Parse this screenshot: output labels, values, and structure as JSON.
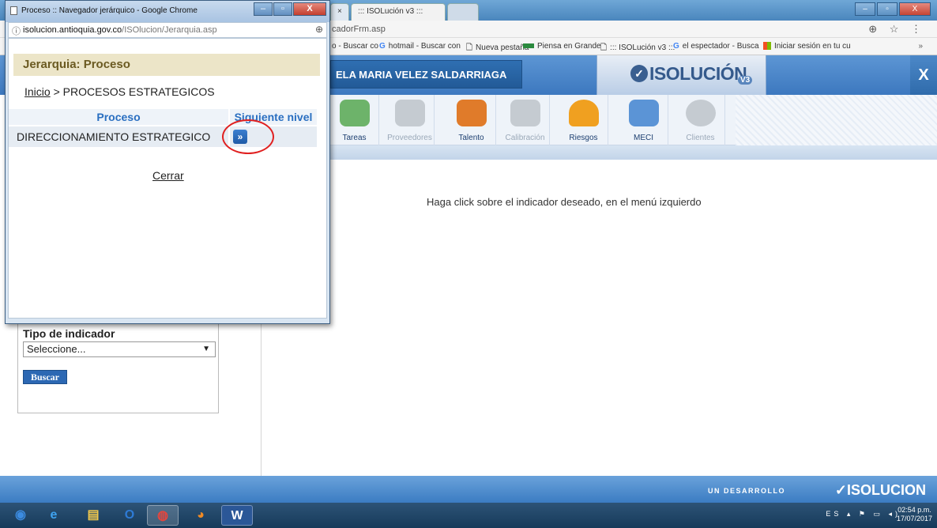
{
  "browser": {
    "tab_title": "::: ISOLución v3 :::",
    "tab_close": "×",
    "url_fragment": "cadorFrm.asp",
    "addr_icons": "⊕ ☆ ⋮",
    "bookmarks": [
      {
        "icon": "",
        "label": "o - Buscar co"
      },
      {
        "icon": "G",
        "label": "hotmail - Buscar con"
      },
      {
        "icon": "🗋",
        "label": "Nueva pestaña"
      },
      {
        "icon": "",
        "label": "Piensa en Grande"
      },
      {
        "icon": "🗋",
        "label": "::: ISOLución v3 :::"
      },
      {
        "icon": "G",
        "label": "el espectador - Busca"
      },
      {
        "icon": "",
        "label": "Iniciar sesión en tu cu"
      }
    ],
    "bookmarks_more": "»",
    "win_controls": {
      "min": "–",
      "max": "▫",
      "close": "X"
    }
  },
  "header": {
    "user_name": "ELA MARIA VELEZ SALDARRIAGA",
    "logo_check": "✓",
    "logo_text": "ISOLUCIÓN",
    "logo_version": "V3",
    "close_label": "X"
  },
  "modules": [
    {
      "label": "Tareas",
      "enabled": true,
      "color": "#6db36a"
    },
    {
      "label": "Proveedores",
      "enabled": false,
      "color": "#c5cbd1"
    },
    {
      "label": "Talento",
      "enabled": true,
      "color": "#e07b2a"
    },
    {
      "label": "Calibración",
      "enabled": false,
      "color": "#c5cbd1"
    },
    {
      "label": "Riesgos",
      "enabled": true,
      "color": "#f0a020"
    },
    {
      "label": "MECI",
      "enabled": true,
      "color": "#5b94d6"
    },
    {
      "label": "Clientes",
      "enabled": false,
      "color": "#c5cbd1"
    }
  ],
  "main": {
    "hint": "Haga click sobre el indicador deseado, en el menú izquierdo"
  },
  "filter": {
    "label": "Tipo de indicador",
    "select_value": "Seleccione...",
    "select_arrow": "▼",
    "search_button": "Buscar"
  },
  "footer": {
    "developer": "UN DESARROLLO",
    "brand": "✓ISOLUCION"
  },
  "taskbar": {
    "items": [
      {
        "name": "start-button",
        "glyph": "◉",
        "color": "#3b8be0"
      },
      {
        "name": "ie-icon",
        "glyph": "e",
        "color": "#3fa3f0"
      },
      {
        "name": "explorer-icon",
        "glyph": "▤",
        "color": "#f2c94c"
      },
      {
        "name": "outlook-icon",
        "glyph": "O",
        "color": "#2e7bd6"
      },
      {
        "name": "chrome-icon",
        "glyph": "◍",
        "color": "#e8453c"
      },
      {
        "name": "firefox-icon",
        "glyph": "◕",
        "color": "#f08a24"
      },
      {
        "name": "word-icon",
        "glyph": "W",
        "color": "#2b5797"
      }
    ],
    "tray": "ES ▴ ⚑ ▭ ◂)",
    "time": "02:54 p.m.",
    "date": "17/07/2017"
  },
  "popup": {
    "title": "Proceso :: Navegador jerárquico - Google Chrome",
    "controls": {
      "min": "–",
      "max": "▫",
      "close": "X"
    },
    "url_host": "isolucion.antioquia.gov.co",
    "url_path": "/ISOlucion/Jerarquia.asp",
    "info_icon": "ⓘ",
    "zoom_icon": "⊕",
    "heading": "Jerarquia: Proceso",
    "crumb_home": "Inicio",
    "crumb_sep": " > ",
    "crumb_current": "PROCESOS ESTRATEGICOS",
    "col_process": "Proceso",
    "col_next": "Siguiente nivel",
    "row_process": "DIRECCIONAMIENTO ESTRATEGICO",
    "next_glyph": "»",
    "close_link": "Cerrar"
  }
}
